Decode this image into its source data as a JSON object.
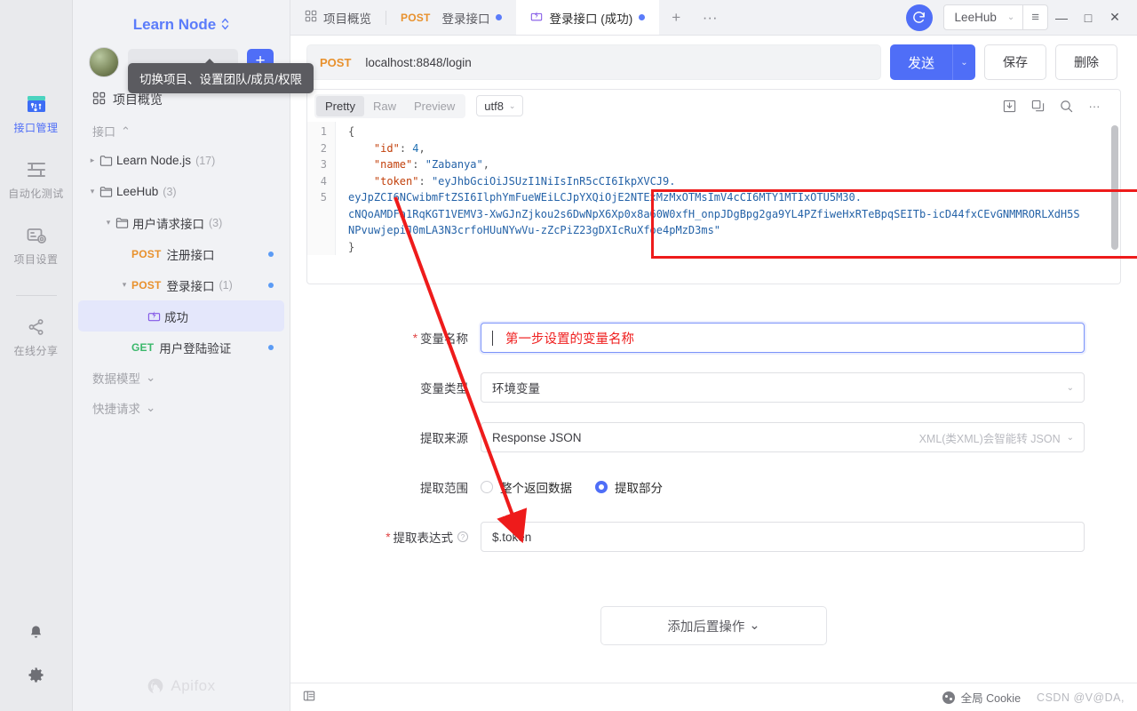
{
  "window": {
    "minimize": "—",
    "maximize": "□",
    "close": "✕",
    "sync_icon": "sync-icon",
    "user_name": "LeeHub",
    "menu_icon": "hamburger-icon"
  },
  "rail": {
    "items": [
      {
        "label": "接口管理",
        "icon": "api-management-icon",
        "active": true
      },
      {
        "label": "自动化测试",
        "icon": "automated-test-icon",
        "active": false
      },
      {
        "label": "项目设置",
        "icon": "project-settings-icon",
        "active": false
      },
      {
        "label": "在线分享",
        "icon": "share-icon",
        "active": false
      }
    ],
    "bottom": [
      {
        "icon": "bell-icon"
      },
      {
        "icon": "gear-icon"
      }
    ]
  },
  "sidebar": {
    "project_name": "Learn Node",
    "project_caret": "⌃⌄",
    "tooltip": "切换项目、设置团队/成员/权限",
    "add_button": "+",
    "overview": "项目概览",
    "section_interface": "接口",
    "section_caret": "⌃",
    "tree": [
      {
        "indent": 0,
        "arrow": "▸",
        "icon": "folder-icon",
        "label": "Learn Node.js",
        "count": "(17)",
        "verb": "",
        "dot": false,
        "selected": false
      },
      {
        "indent": 0,
        "arrow": "▾",
        "icon": "folder-open-icon",
        "label": "LeeHub",
        "count": "(3)",
        "verb": "",
        "dot": false,
        "selected": false
      },
      {
        "indent": 1,
        "arrow": "▾",
        "icon": "folder-open-icon",
        "label": "用户请求接口",
        "count": "(3)",
        "verb": "",
        "dot": false,
        "selected": false
      },
      {
        "indent": 2,
        "arrow": "",
        "icon": "",
        "label": "注册接口",
        "count": "",
        "verb": "POST",
        "dot": true,
        "selected": false
      },
      {
        "indent": 2,
        "arrow": "▾",
        "icon": "",
        "label": "登录接口",
        "count": "(1)",
        "verb": "POST",
        "dot": true,
        "selected": false
      },
      {
        "indent": 3,
        "arrow": "",
        "icon": "case-icon",
        "label": "成功",
        "count": "",
        "verb": "",
        "dot": false,
        "selected": true
      },
      {
        "indent": 2,
        "arrow": "",
        "icon": "",
        "label": "用户登陆验证",
        "count": "",
        "verb": "GET",
        "dot": true,
        "selected": false
      }
    ],
    "groups": [
      {
        "label": "数据模型",
        "caret": "⌄"
      },
      {
        "label": "快捷请求",
        "caret": "⌄"
      }
    ],
    "watermark": "Apifox"
  },
  "tabs": [
    {
      "label": "项目概览",
      "icon": "grid-icon",
      "verb": "",
      "dot": false,
      "active": false
    },
    {
      "label": "登录接口",
      "icon": "",
      "verb": "POST",
      "dot": true,
      "active": false
    },
    {
      "label": "登录接口 (成功)",
      "icon": "case-icon",
      "verb": "",
      "dot": true,
      "active": true
    }
  ],
  "tab_plus": "+",
  "tab_more": "···",
  "request": {
    "method": "POST",
    "url": "localhost:8848/login",
    "send_label": "发送",
    "send_caret": "⌄",
    "save_label": "保存",
    "delete_label": "删除"
  },
  "response": {
    "view_tabs": [
      {
        "label": "Pretty",
        "active": true
      },
      {
        "label": "Raw",
        "active": false
      },
      {
        "label": "Preview",
        "active": false
      }
    ],
    "encoding": "utf8",
    "encoding_caret": "⌄",
    "tools": [
      {
        "icon": "download-icon"
      },
      {
        "icon": "copy-icon"
      },
      {
        "icon": "search-icon"
      },
      {
        "icon": "more-icon"
      }
    ],
    "line_numbers": [
      "1",
      "2",
      "3",
      "4",
      "5"
    ],
    "body_lines": [
      {
        "segments": [
          {
            "t": "{",
            "c": "p"
          }
        ]
      },
      {
        "segments": [
          {
            "t": "    ",
            "c": "p"
          },
          {
            "t": "\"id\"",
            "c": "k"
          },
          {
            "t": ": ",
            "c": "p"
          },
          {
            "t": "4",
            "c": "n"
          },
          {
            "t": ",",
            "c": "p"
          }
        ]
      },
      {
        "segments": [
          {
            "t": "    ",
            "c": "p"
          },
          {
            "t": "\"name\"",
            "c": "k"
          },
          {
            "t": ": ",
            "c": "p"
          },
          {
            "t": "\"Zabanya\"",
            "c": "s"
          },
          {
            "t": ",",
            "c": "p"
          }
        ]
      },
      {
        "segments": [
          {
            "t": "    ",
            "c": "p"
          },
          {
            "t": "\"token\"",
            "c": "k"
          },
          {
            "t": ": ",
            "c": "p"
          },
          {
            "t": "\"eyJhbGciOiJSUzI1NiIsInR5cCI6IkpXVCJ9.",
            "c": "s"
          }
        ]
      },
      {
        "segments": [
          {
            "t": "eyJpZCI6NCwibmFtZSI6IlphYmFueWEiLCJpYXQiOjE2NTExMzMxOTMsImV4cCI6MTY1MTIxOTU5M30.",
            "c": "s"
          }
        ]
      },
      {
        "segments": [
          {
            "t": "cNQoAMDFa1RqKGT1VEMV3-XwGJnZjkou2s6DwNpX6Xp0x8a60W0xfH_onpJDgBpg2ga9YL4PZfiweHxRTeBpqSEITb-icD44fxCEvGNMMRORLXdH5S",
            "c": "s"
          }
        ]
      },
      {
        "segments": [
          {
            "t": "NPvuwjepiJ0mLA3N3crfoHUuNYwVu-zZcPiZ23gDXIcRuXfoe4pMzD3ms\"",
            "c": "s"
          }
        ]
      },
      {
        "segments": [
          {
            "t": "}",
            "c": "p"
          }
        ]
      }
    ]
  },
  "form": {
    "rows": [
      {
        "name": "variable-name",
        "required": true,
        "label": "变量名称",
        "type": "input",
        "value": "",
        "annotation": "第一步设置的变量名称",
        "focused": true
      },
      {
        "name": "variable-type",
        "required": false,
        "label": "变量类型",
        "type": "select",
        "value": "环境变量",
        "hint": "",
        "caret": "⌄"
      },
      {
        "name": "extract-source",
        "required": false,
        "label": "提取来源",
        "type": "select",
        "value": "Response JSON",
        "hint": "XML(类XML)会智能转 JSON",
        "caret": "⌄"
      },
      {
        "name": "extract-scope",
        "required": false,
        "label": "提取范围",
        "type": "radio",
        "options": [
          {
            "label": "整个返回数据",
            "checked": false
          },
          {
            "label": "提取部分",
            "checked": true
          }
        ]
      },
      {
        "name": "extract-expression",
        "required": true,
        "label": "提取表达式",
        "help": "?",
        "type": "input",
        "value": "$.token",
        "focused": false
      }
    ],
    "add_operation": "添加后置操作",
    "add_operation_caret": "⌄"
  },
  "statusbar": {
    "left_icon": "layout-panel-icon",
    "cookie_label": "全局 Cookie",
    "watermark": "CSDN @V@DA,"
  },
  "colors": {
    "accent": "#4f6ef7",
    "post": "#e8912d",
    "get": "#3bb86b",
    "annotation": "#ee1b1b",
    "sidebar_bg": "#f1f2f5",
    "rail_bg": "#e9eaed"
  }
}
